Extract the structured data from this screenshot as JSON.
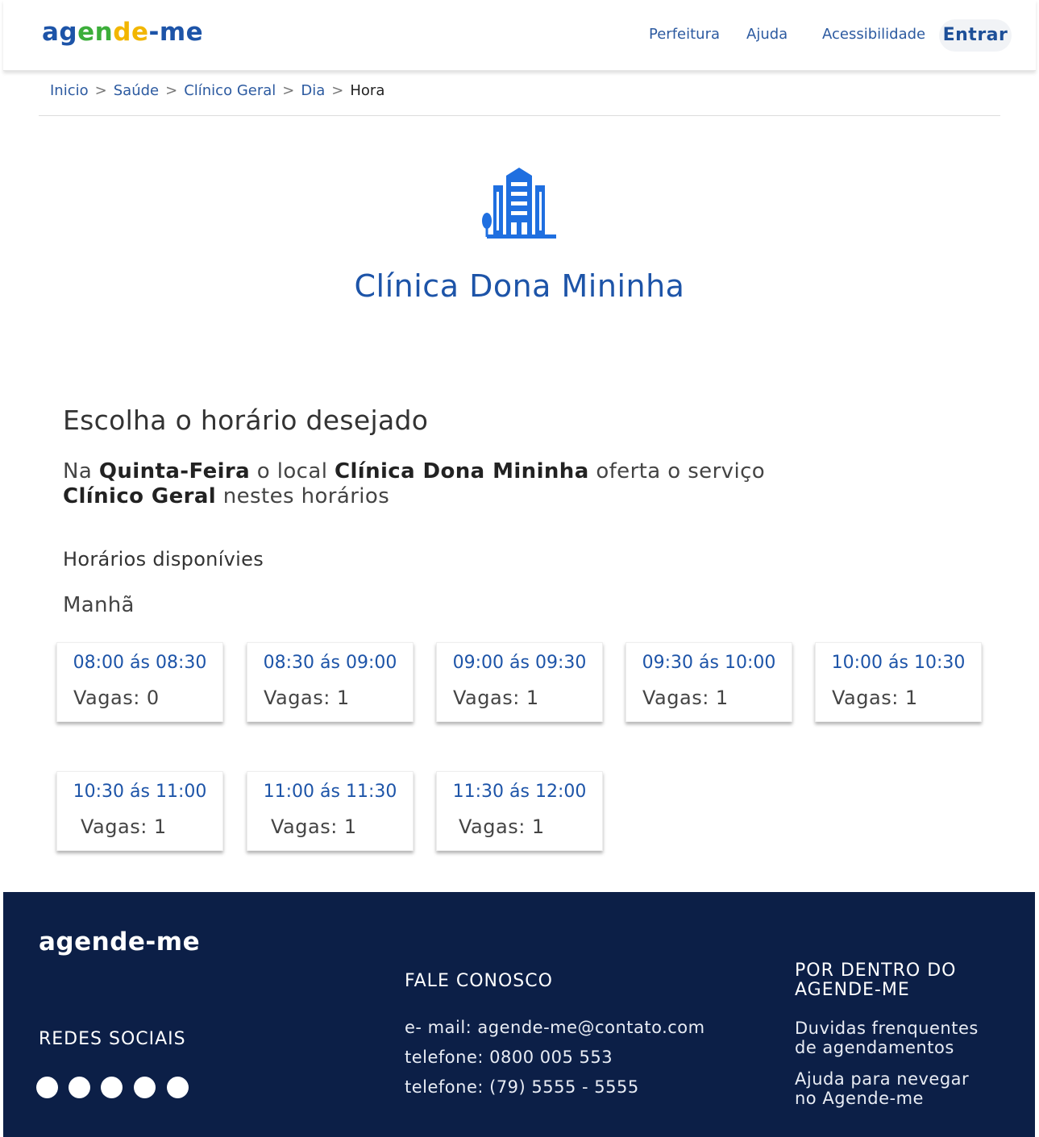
{
  "header": {
    "logo": [
      "a",
      "g",
      "e",
      "n",
      "d",
      "e",
      "-",
      "m",
      "e"
    ],
    "nav": [
      "Perfeitura",
      "Ajuda",
      "Acessibilidade"
    ],
    "login_label": "Entrar"
  },
  "breadcrumb": [
    "Inicio",
    "Saúde",
    "Clínico Geral",
    "Dia",
    "Hora"
  ],
  "breadcrumb_separator": ">",
  "clinic": {
    "icon": "hospital-building-icon",
    "name": "Clínica Dona Mininha"
  },
  "content": {
    "heading": "Escolha o horário desejado",
    "desc_1": "Na ",
    "day": "Quinta-Feira",
    "desc_2": " o local ",
    "place": "Clínica Dona Mininha",
    "desc_3": " oferta o serviço ",
    "service": "Clínico Geral",
    "desc_4": " nestes horários",
    "available_heading": "Horários disponívies",
    "period": "Manhã"
  },
  "slots": [
    {
      "time": "08:00 ás 08:30",
      "vagas": "Vagas: 0"
    },
    {
      "time": "08:30 ás 09:00",
      "vagas": "Vagas: 1"
    },
    {
      "time": "09:00 ás 09:30",
      "vagas": "Vagas: 1"
    },
    {
      "time": "09:30 ás 10:00",
      "vagas": "Vagas: 1"
    },
    {
      "time": "10:00 ás 10:30",
      "vagas": "Vagas: 1"
    },
    {
      "time": "10:30 ás 11:00",
      "vagas": "Vagas: 1"
    },
    {
      "time": "11:00 ás 11:30",
      "vagas": "Vagas: 1"
    },
    {
      "time": "11:30 ás 12:00",
      "vagas": "Vagas: 1"
    }
  ],
  "footer": {
    "logo": "agende-me",
    "social_title": "REDES SOCIAIS",
    "social_icons": [
      "social-icon-1",
      "social-icon-2",
      "social-icon-3",
      "social-icon-4",
      "social-icon-5"
    ],
    "contact_title": "FALE CONOSCO",
    "email": "e- mail: agende-me@contato.com",
    "phone_1": "telefone: 0800 005 553",
    "phone_2": "telefone: (79) 5555 - 5555",
    "inside_title": "POR DENTRO DO AGENDE-ME",
    "link_faq": "Duvidas frenquentes de agendamentos",
    "link_help": "Ajuda para nevegar no Agende-me"
  },
  "colors": {
    "brand_blue": "#1d54a8",
    "brand_green": "#3cae3a",
    "brand_yellow": "#f2b600",
    "footer_bg": "#0c1f47"
  }
}
